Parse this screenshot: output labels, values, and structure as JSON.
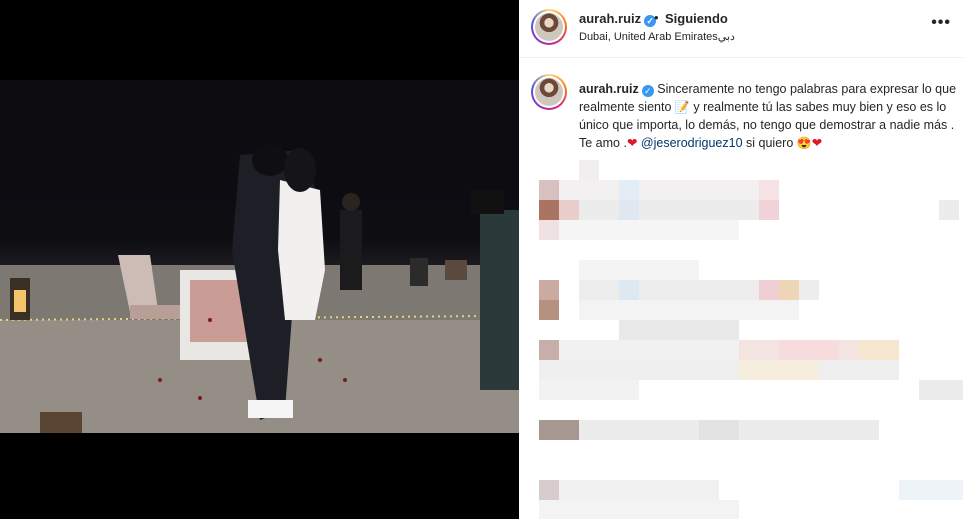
{
  "post": {
    "username": "aurah.ruiz",
    "follow_status": "Siguiendo",
    "location": "Dubai, United Arab Emiratesدبي",
    "caption": {
      "part1": "Sinceramente no tengo palabras para expresar lo que realmente siento",
      "part2": "y realmente tú las sabes muy bien y eso es lo único que importa, lo demás, no tengo que demostrar a nadie más . Te amo .",
      "mention": "@jeserodriguez10",
      "part3": "si quiero"
    }
  },
  "icons": {
    "verified": "verified-badge-icon",
    "more": "more-options-icon",
    "memo": "memo-emoji",
    "heart": "red-heart-emoji",
    "heart_eyes": "heart-eyes-emoji"
  },
  "colors": {
    "accent_blue": "#3897f0",
    "mention": "#00376b",
    "heart": "#e0162b"
  }
}
